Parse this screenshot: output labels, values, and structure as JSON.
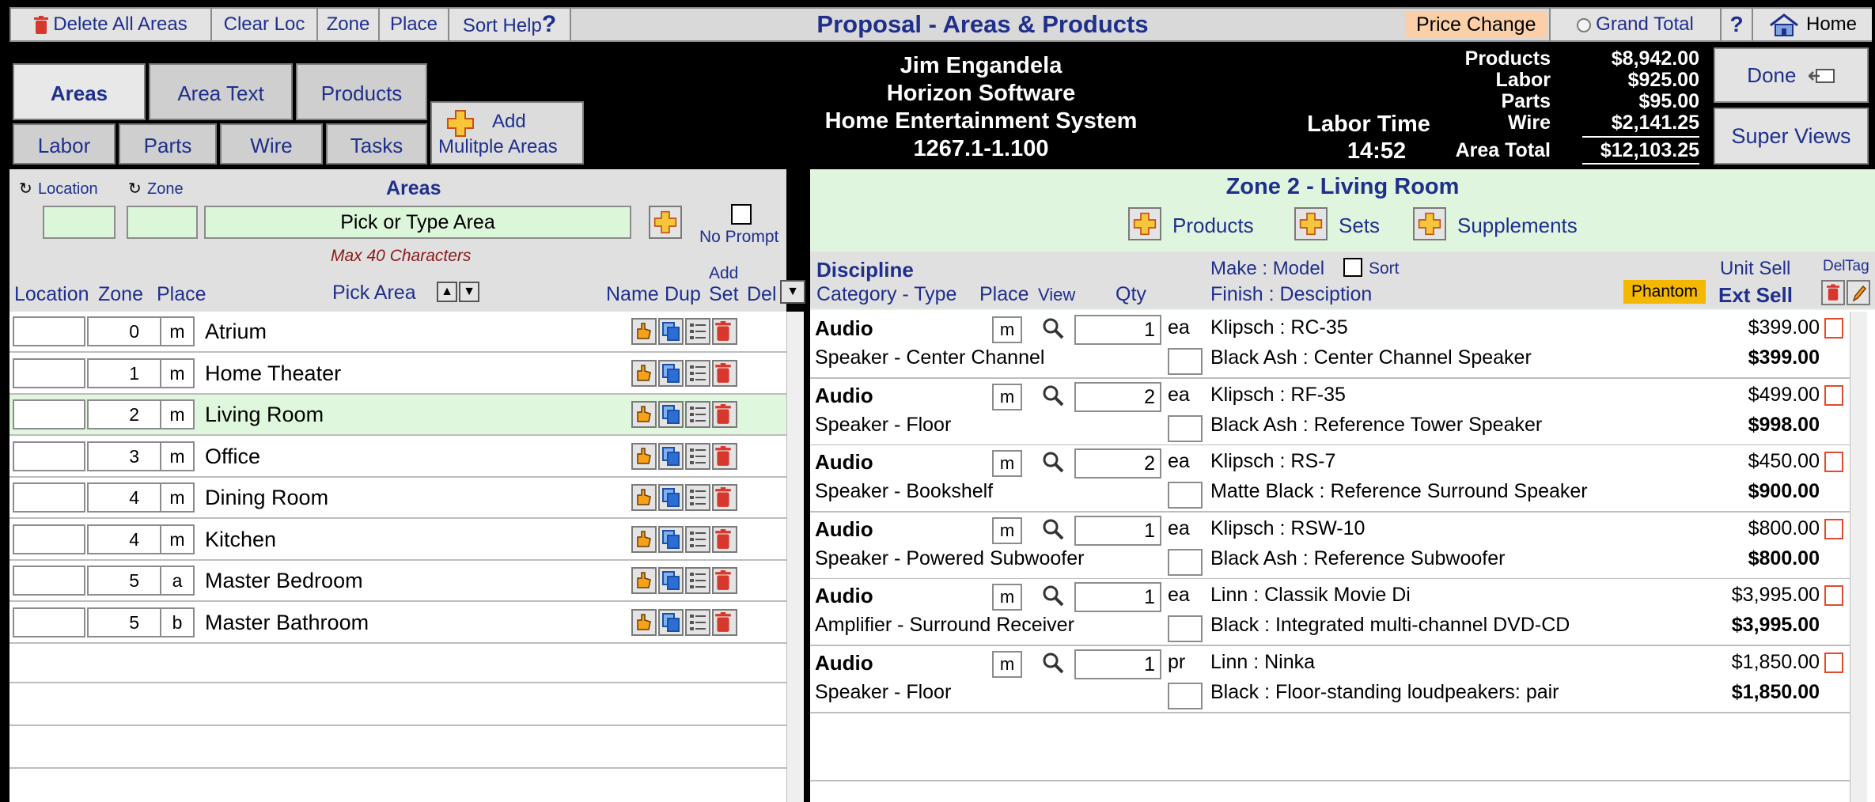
{
  "toolbar": {
    "delete_all": "Delete All Areas",
    "clear_loc": "Clear Loc",
    "zone": "Zone",
    "place": "Place",
    "sort_help": "Sort Help",
    "title": "Proposal - Areas & Products",
    "price_change": "Price Change",
    "grand_total": "Grand Total",
    "help": "?",
    "home": "Home"
  },
  "tabs": {
    "areas": "Areas",
    "area_text": "Area Text",
    "products": "Products",
    "labor": "Labor",
    "parts": "Parts",
    "wire": "Wire",
    "tasks": "Tasks",
    "add": "Add",
    "add_multiple": "Mulitple Areas"
  },
  "header": {
    "client": "Jim Engandela",
    "company": "Horizon Software",
    "system": "Home Entertainment System",
    "proposal_no": "1267.1-1.100",
    "labor_time_label": "Labor Time",
    "labor_time": "14:52",
    "done": "Done",
    "super_views": "Super Views"
  },
  "totals": {
    "products_label": "Products",
    "products": "$8,942.00",
    "labor_label": "Labor",
    "labor": "$925.00",
    "parts_label": "Parts",
    "parts": "$95.00",
    "wire_label": "Wire",
    "wire": "$2,141.25",
    "area_total_label": "Area Total",
    "area_total": "$12,103.25"
  },
  "left": {
    "location": "Location",
    "zone": "Zone",
    "areas_title": "Areas",
    "area_placeholder": "Pick or Type Area",
    "no_prompt": "No Prompt",
    "max_chars": "Max 40 Characters",
    "col_location": "Location",
    "col_zone": "Zone",
    "col_place": "Place",
    "pick_area": "Pick Area",
    "col_name": "Name",
    "col_dup": "Dup",
    "col_add": "Add",
    "col_set": "Set",
    "col_del": "Del",
    "rows": [
      {
        "location": "",
        "zone": "0",
        "place": "m",
        "name": "Atrium"
      },
      {
        "location": "",
        "zone": "1",
        "place": "m",
        "name": "Home Theater"
      },
      {
        "location": "",
        "zone": "2",
        "place": "m",
        "name": "Living Room"
      },
      {
        "location": "",
        "zone": "3",
        "place": "m",
        "name": "Office"
      },
      {
        "location": "",
        "zone": "4",
        "place": "m",
        "name": "Dining Room"
      },
      {
        "location": "",
        "zone": "4",
        "place": "m",
        "name": "Kitchen"
      },
      {
        "location": "",
        "zone": "5",
        "place": "a",
        "name": "Master Bedroom"
      },
      {
        "location": "",
        "zone": "5",
        "place": "b",
        "name": "Master Bathroom"
      }
    ]
  },
  "right": {
    "zone_title": "Zone 2 - Living Room",
    "products_btn": "Products",
    "sets_btn": "Sets",
    "supplements_btn": "Supplements",
    "col_discipline": "Discipline",
    "col_category": "Category - Type",
    "col_place": "Place",
    "col_view": "View",
    "col_qty": "Qty",
    "col_make": "Make : Model",
    "col_sort": "Sort",
    "col_finish": "Finish : Desciption",
    "phantom": "Phantom",
    "col_unit_sell": "Unit Sell",
    "col_ext_sell": "Ext Sell",
    "col_del": "Del",
    "col_tag": "Tag",
    "products": [
      {
        "discipline": "Audio",
        "category": "Speaker - Center Channel",
        "place": "m",
        "qty": "1",
        "unit": "ea",
        "make": "Klipsch : RC-35",
        "finish": "Black Ash : Center Channel Speaker",
        "unit_sell": "$399.00",
        "ext_sell": "$399.00"
      },
      {
        "discipline": "Audio",
        "category": "Speaker - Floor",
        "place": "m",
        "qty": "2",
        "unit": "ea",
        "make": "Klipsch : RF-35",
        "finish": "Black Ash : Reference Tower Speaker",
        "unit_sell": "$499.00",
        "ext_sell": "$998.00"
      },
      {
        "discipline": "Audio",
        "category": "Speaker - Bookshelf",
        "place": "m",
        "qty": "2",
        "unit": "ea",
        "make": "Klipsch : RS-7",
        "finish": "Matte Black : Reference Surround Speaker",
        "unit_sell": "$450.00",
        "ext_sell": "$900.00"
      },
      {
        "discipline": "Audio",
        "category": "Speaker - Powered Subwoofer",
        "place": "m",
        "qty": "1",
        "unit": "ea",
        "make": "Klipsch : RSW-10",
        "finish": "Black Ash : Reference Subwoofer",
        "unit_sell": "$800.00",
        "ext_sell": "$800.00"
      },
      {
        "discipline": "Audio",
        "category": "Amplifier - Surround Receiver",
        "place": "m",
        "qty": "1",
        "unit": "ea",
        "make": "Linn : Classik Movie Di",
        "finish": "Black : Integrated multi-channel DVD-CD",
        "unit_sell": "$3,995.00",
        "ext_sell": "$3,995.00"
      },
      {
        "discipline": "Audio",
        "category": "Speaker - Floor",
        "place": "m",
        "qty": "1",
        "unit": "pr",
        "make": "Linn : Ninka",
        "finish": "Black : Floor-standing loudpeakers: pair",
        "unit_sell": "$1,850.00",
        "ext_sell": "$1,850.00"
      }
    ]
  },
  "colors": {
    "accent_blue": "#1f2f8c",
    "selected_row": "#dff7dc",
    "price_change": "#fbd0a8",
    "phantom": "#f5b800",
    "delete_red": "#d8372b"
  }
}
